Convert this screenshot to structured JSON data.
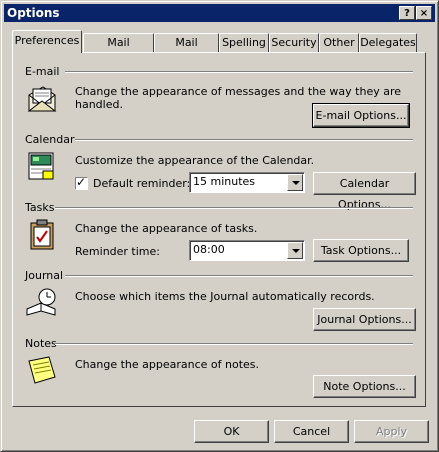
{
  "window": {
    "title": "Options",
    "help_glyph": "?",
    "close_glyph": "×"
  },
  "tabs": [
    "Preferences",
    "Mail Services",
    "Mail Format",
    "Spelling",
    "Security",
    "Other",
    "Delegates"
  ],
  "sections": {
    "email": {
      "title": "E-mail",
      "description": "Change the appearance of messages and the way they are handled.",
      "button": "E-mail Options...",
      "icon": "envelope-icon"
    },
    "calendar": {
      "title": "Calendar",
      "description": "Customize the appearance of the Calendar.",
      "button": "Calendar Options...",
      "icon": "calendar-icon",
      "reminder_label": "Default reminder:",
      "reminder_checked": true,
      "reminder_value": "15 minutes"
    },
    "tasks": {
      "title": "Tasks",
      "description": "Change the appearance of tasks.",
      "button": "Task Options...",
      "icon": "tasks-icon",
      "reminder_label": "Reminder time:",
      "reminder_value": "08:00"
    },
    "journal": {
      "title": "Journal",
      "description": "Choose which items the Journal automatically records.",
      "button": "Journal Options...",
      "icon": "journal-icon"
    },
    "notes": {
      "title": "Notes",
      "description": "Change the appearance of notes.",
      "button": "Note Options...",
      "icon": "note-icon"
    }
  },
  "footer": {
    "ok": "OK",
    "cancel": "Cancel",
    "apply": "Apply",
    "apply_enabled": false
  },
  "check_glyph": "✓"
}
